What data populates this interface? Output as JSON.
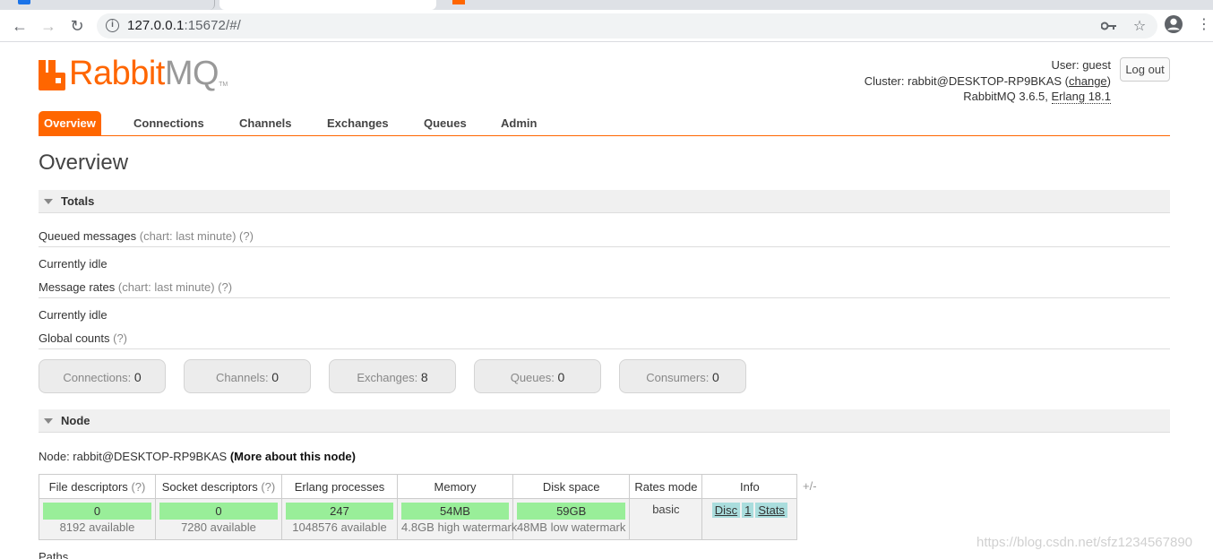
{
  "browser": {
    "url_host": "127.0.0.1",
    "url_rest": ":15672/#/"
  },
  "header": {
    "user_label": "User:",
    "user": "guest",
    "logout": "Log out",
    "cluster_label": "Cluster:",
    "cluster": "rabbit@DESKTOP-RP9BKAS",
    "change": "change",
    "version": "RabbitMQ 3.6.5,",
    "erlang": "Erlang 18.1"
  },
  "logo": {
    "rabbit": "Rabbit",
    "mq": "MQ",
    "tm": "TM"
  },
  "tabs": [
    "Overview",
    "Connections",
    "Channels",
    "Exchanges",
    "Queues",
    "Admin"
  ],
  "page_title": "Overview",
  "totals": {
    "heading": "Totals",
    "queued_label": "Queued messages",
    "queued_note": "(chart: last minute) (?)",
    "idle1": "Currently idle",
    "rates_label": "Message rates",
    "rates_note": "(chart: last minute) (?)",
    "idle2": "Currently idle",
    "global_label": "Global counts",
    "global_note": "(?)",
    "counts": [
      {
        "label": "Connections:",
        "value": "0"
      },
      {
        "label": "Channels:",
        "value": "0"
      },
      {
        "label": "Exchanges:",
        "value": "8"
      },
      {
        "label": "Queues:",
        "value": "0"
      },
      {
        "label": "Consumers:",
        "value": "0"
      }
    ]
  },
  "node": {
    "heading": "Node",
    "node_prefix": "Node: rabbit@DESKTOP-RP9BKAS",
    "more": "(More about this node)",
    "plusminus": "+/-",
    "headers": {
      "fd": "File descriptors",
      "fd_q": "(?)",
      "sd": "Socket descriptors",
      "sd_q": "(?)",
      "ep": "Erlang processes",
      "mem": "Memory",
      "disk": "Disk space",
      "rates": "Rates mode",
      "info": "Info"
    },
    "row": {
      "fd": "0",
      "fd_avail": "8192 available",
      "sd": "0",
      "sd_avail": "7280 available",
      "ep": "247",
      "ep_avail": "1048576 available",
      "mem": "54MB",
      "mem_wm": "4.8GB high watermark",
      "disk": "59GB",
      "disk_wm": "48MB low watermark",
      "rates": "basic",
      "info": [
        "Disc",
        "1",
        "Stats"
      ]
    },
    "paths": "Paths"
  },
  "watermark": "https://blog.csdn.net/sfz1234567890"
}
